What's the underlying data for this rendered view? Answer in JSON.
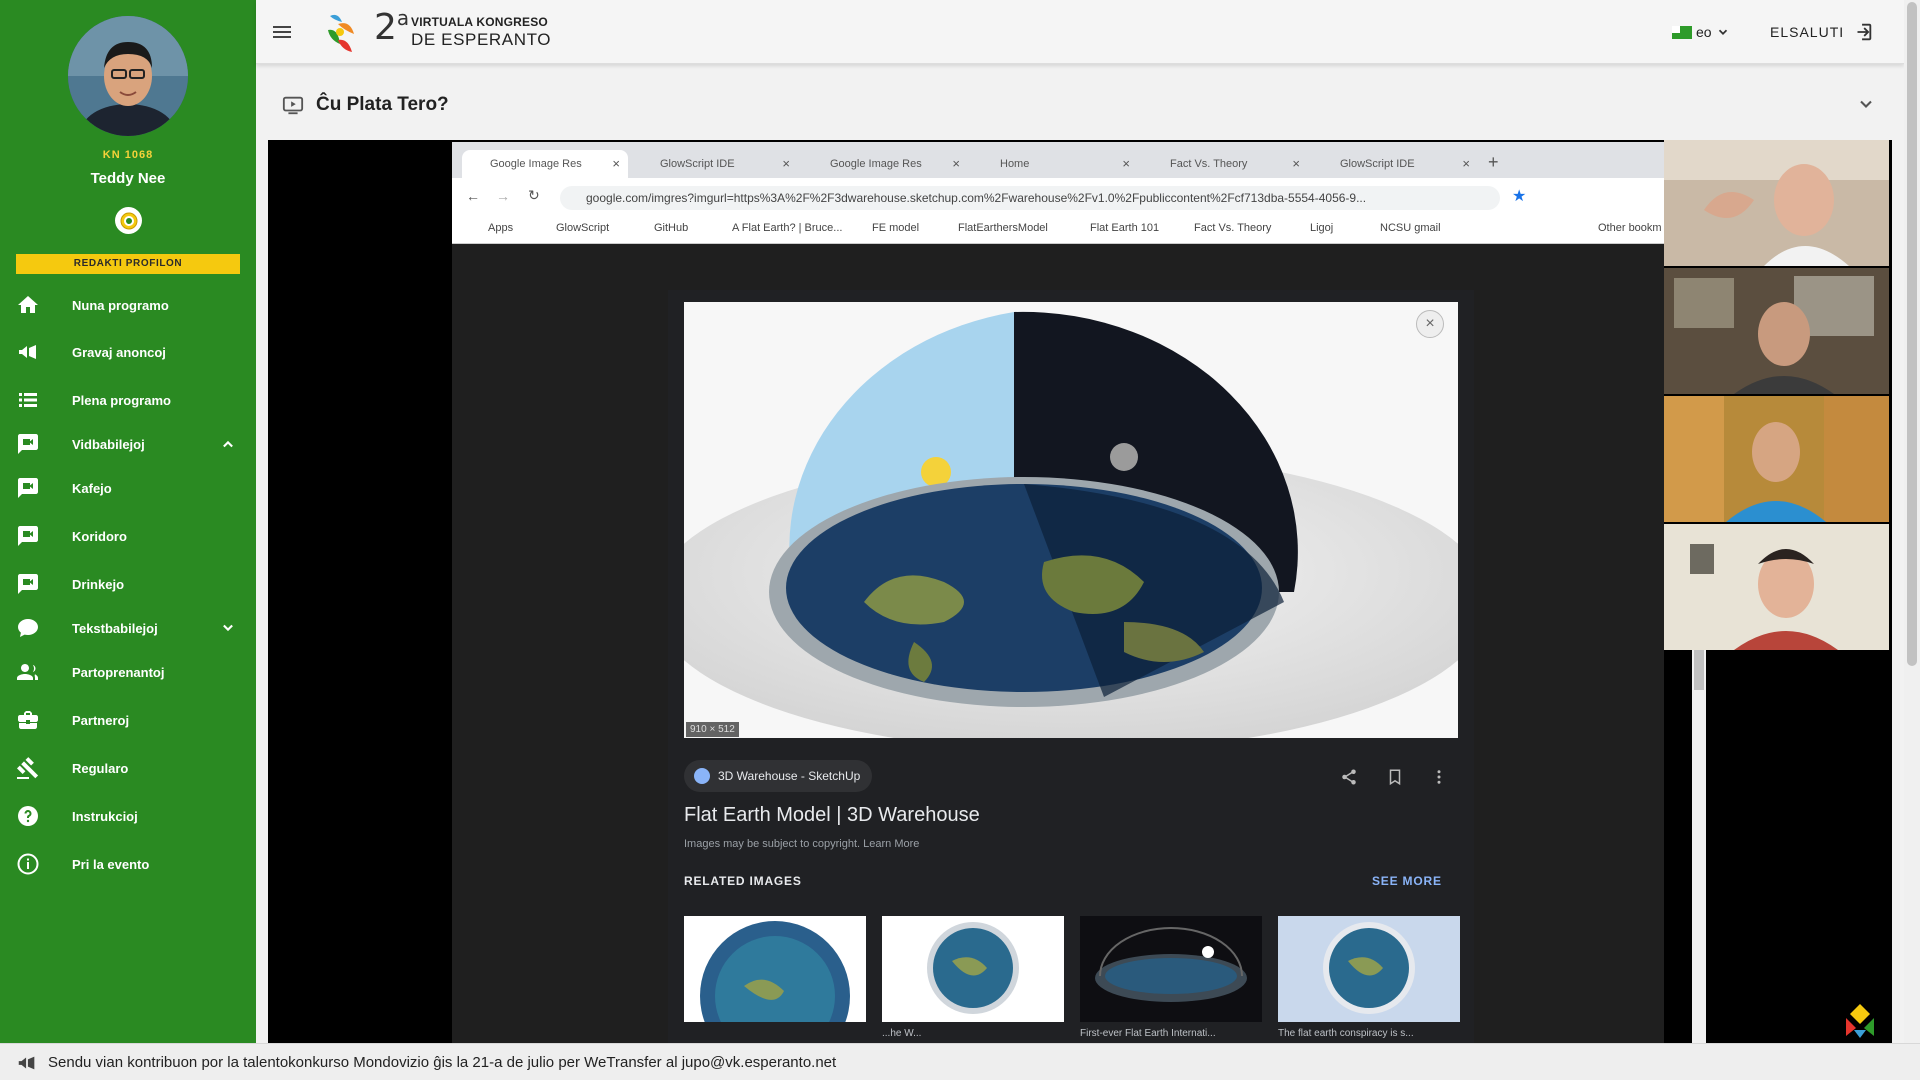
{
  "user": {
    "code": "KN 1068",
    "name": "Teddy Nee",
    "edit_profile_label": "REDAKTI PROFILON"
  },
  "nav": {
    "items": [
      {
        "label": "Nuna programo",
        "icon": "home-icon"
      },
      {
        "label": "Gravaj anoncoj",
        "icon": "megaphone-icon"
      },
      {
        "label": "Plena programo",
        "icon": "list-icon"
      },
      {
        "label": "Vidbabilejoj",
        "icon": "video-chat-icon"
      },
      {
        "label": "Kafejo",
        "icon": "video-chat-icon"
      },
      {
        "label": "Koridoro",
        "icon": "video-chat-icon"
      },
      {
        "label": "Drinkejo",
        "icon": "video-chat-icon"
      },
      {
        "label": "Tekstbabilejoj",
        "icon": "chat-bubble-icon"
      },
      {
        "label": "Partoprenantoj",
        "icon": "people-icon"
      },
      {
        "label": "Partneroj",
        "icon": "briefcase-icon"
      },
      {
        "label": "Regularo",
        "icon": "gavel-icon"
      },
      {
        "label": "Instrukcioj",
        "icon": "help-icon"
      },
      {
        "label": "Pri la evento",
        "icon": "info-icon"
      }
    ]
  },
  "header": {
    "logo_number": "2",
    "logo_superscript": "a",
    "logo_line1": "VIRTUALA KONGRESO",
    "logo_line2": "DE ESPERANTO",
    "language": "eo",
    "logout_label": "ELSALUTI"
  },
  "panel": {
    "title": "Ĉu Plata Tero?"
  },
  "video": {
    "browser": {
      "tabs": [
        "Google Image Res",
        "GlowScript IDE",
        "Google Image Res",
        "Home",
        "Fact Vs. Theory",
        "GlowScript IDE"
      ],
      "url": "google.com/imgres?imgurl=https%3A%2F%2F3dwarehouse.sketchup.com%2Fwarehouse%2Fv1.0%2Fpubliccontent%2Fcf713dba-5554-4056-9...",
      "bookmarks": [
        "Apps",
        "GlowScript",
        "GitHub",
        "A Flat Earth? | Bruce...",
        "FE model",
        "FlatEarthersModel",
        "Flat Earth 101",
        "Fact Vs. Theory",
        "Ligoj",
        "NCSU gmail",
        "Other bookm"
      ]
    },
    "image_viewer": {
      "dimensions": "910 × 512",
      "source": "3D Warehouse - SketchUp",
      "title": "Flat Earth Model | 3D Warehouse",
      "copyright": "Images may be subject to copyright. Learn More",
      "related_label": "RELATED IMAGES",
      "see_more_label": "SEE MORE",
      "thumb_captions": [
        "",
        "...he W...",
        "First-ever Flat Earth Internati...",
        "The flat earth conspiracy is s..."
      ]
    }
  },
  "footer": {
    "announcement": "Sendu vian kontribuon por la talentokonkurso Mondovizio ĝis la 21-a de julio per WeTransfer al jupo@vk.esperanto.net"
  },
  "colors": {
    "sidebar": "#2a8a22",
    "accent_yellow": "#f5c90f"
  }
}
